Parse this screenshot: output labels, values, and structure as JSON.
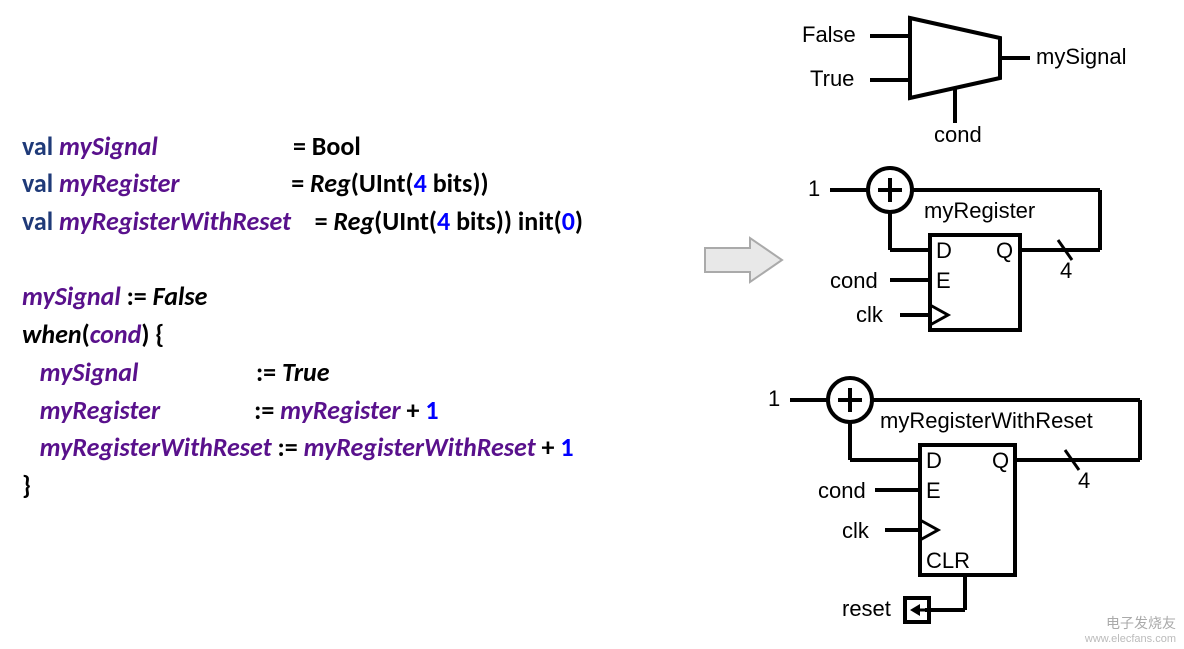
{
  "code": {
    "l1": {
      "kw": "val",
      "id": "mySignal",
      "eq": "= Bool"
    },
    "l2": {
      "kw": "val",
      "id": "myRegister",
      "eq1": "= ",
      "fn": "Reg",
      "open": "(UInt(",
      "num": "4",
      "mid": " bits))"
    },
    "l3": {
      "kw": "val",
      "id": "myRegisterWithReset",
      "eq1": "= ",
      "fn": "Reg",
      "open": "(UInt(",
      "num": "4",
      "mid": " bits)) init(",
      "num2": "0",
      "close": ")"
    },
    "l5": {
      "id": "mySignal",
      "op": " := ",
      "fn": "False"
    },
    "l6": {
      "fn": "when",
      "open": "(",
      "id": "cond",
      "close": ") {"
    },
    "l7": {
      "id": "mySignal",
      "op": ":= ",
      "fn": "True"
    },
    "l8": {
      "id": "myRegister",
      "op": ":= ",
      "id2": "myRegister",
      "plus": " + ",
      "num": "1"
    },
    "l9": {
      "id": "myRegisterWithReset",
      "op": " := ",
      "id2": "myRegisterWithReset",
      "plus": " + ",
      "num": "1"
    },
    "l10": {
      "close": "}"
    }
  },
  "diagram": {
    "mux": {
      "in0": "False",
      "in1": "True",
      "out": "mySignal",
      "sel": "cond"
    },
    "reg1": {
      "name": "myRegister",
      "one": "1",
      "plus": "+",
      "D": "D",
      "Q": "Q",
      "E": "E",
      "clk": "clk",
      "cond": "cond",
      "width": "4"
    },
    "reg2": {
      "name": "myRegisterWithReset",
      "one": "1",
      "plus": "+",
      "D": "D",
      "Q": "Q",
      "E": "E",
      "clk": "clk",
      "cond": "cond",
      "CLR": "CLR",
      "reset": "reset",
      "width": "4"
    }
  },
  "watermark": {
    "brand": "电子发烧友",
    "url": "www.elecfans.com"
  }
}
